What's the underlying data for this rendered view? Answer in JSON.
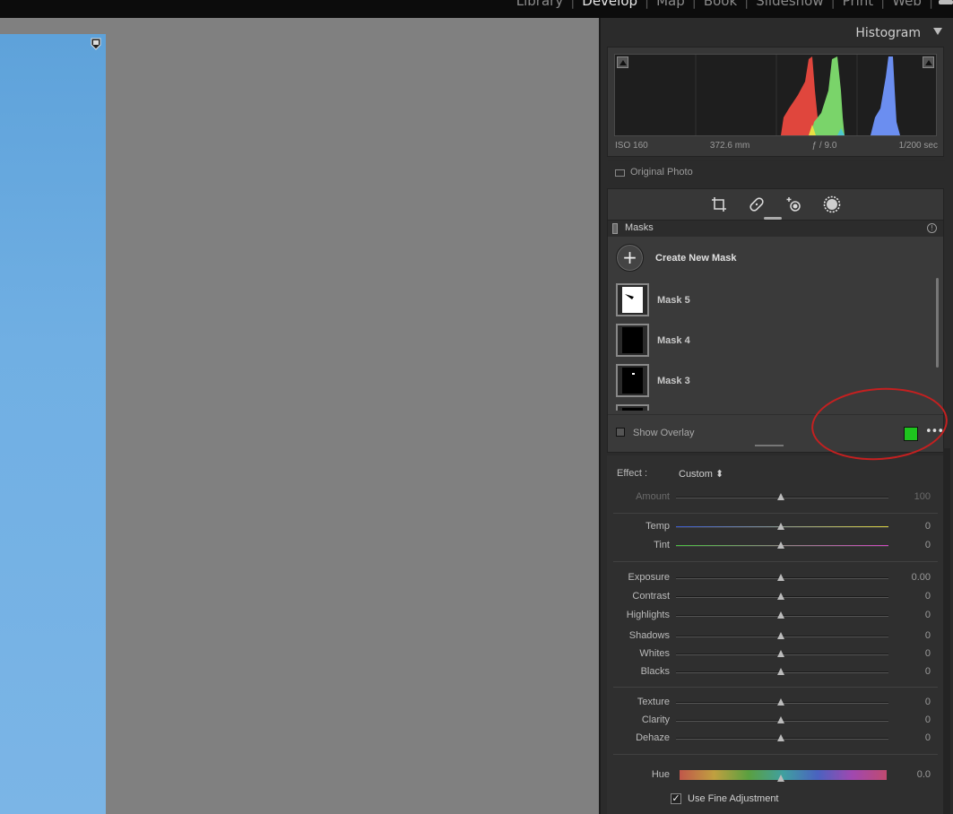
{
  "modules": [
    "Library",
    "Develop",
    "Map",
    "Book",
    "Slideshow",
    "Print",
    "Web"
  ],
  "active_module": "Develop",
  "histogram": {
    "title": "Histogram",
    "iso": "ISO 160",
    "focal": "372.6 mm",
    "aperture": "ƒ / 9.0",
    "shutter": "1/200 sec",
    "original_photo_label": "Original Photo"
  },
  "tools": [
    "crop-icon",
    "healing-icon",
    "red-eye-icon",
    "masking-icon"
  ],
  "masks": {
    "title": "Masks",
    "create_label": "Create New Mask",
    "items": [
      {
        "label": "Mask 5",
        "thumb": "white"
      },
      {
        "label": "Mask 4",
        "thumb": "black"
      },
      {
        "label": "Mask 3",
        "thumb": "black"
      },
      {
        "label": "",
        "thumb": "black"
      }
    ],
    "show_overlay_label": "Show Overlay",
    "overlay_color": "#1ec51e"
  },
  "effect": {
    "label": "Effect :",
    "value": "Custom ⬍"
  },
  "sliders": [
    {
      "label": "Amount",
      "value": "100",
      "disabled": true
    },
    {
      "label": "Temp",
      "value": "0"
    },
    {
      "label": "Tint",
      "value": "0"
    },
    {
      "label": "Exposure",
      "value": "0.00"
    },
    {
      "label": "Contrast",
      "value": "0"
    },
    {
      "label": "Highlights",
      "value": "0"
    },
    {
      "label": "Shadows",
      "value": "0"
    },
    {
      "label": "Whites",
      "value": "0"
    },
    {
      "label": "Blacks",
      "value": "0"
    },
    {
      "label": "Texture",
      "value": "0"
    },
    {
      "label": "Clarity",
      "value": "0"
    },
    {
      "label": "Dehaze",
      "value": "0"
    },
    {
      "label": "Hue",
      "value": "0.0"
    }
  ],
  "fine_adjustment_label": "Use Fine Adjustment"
}
